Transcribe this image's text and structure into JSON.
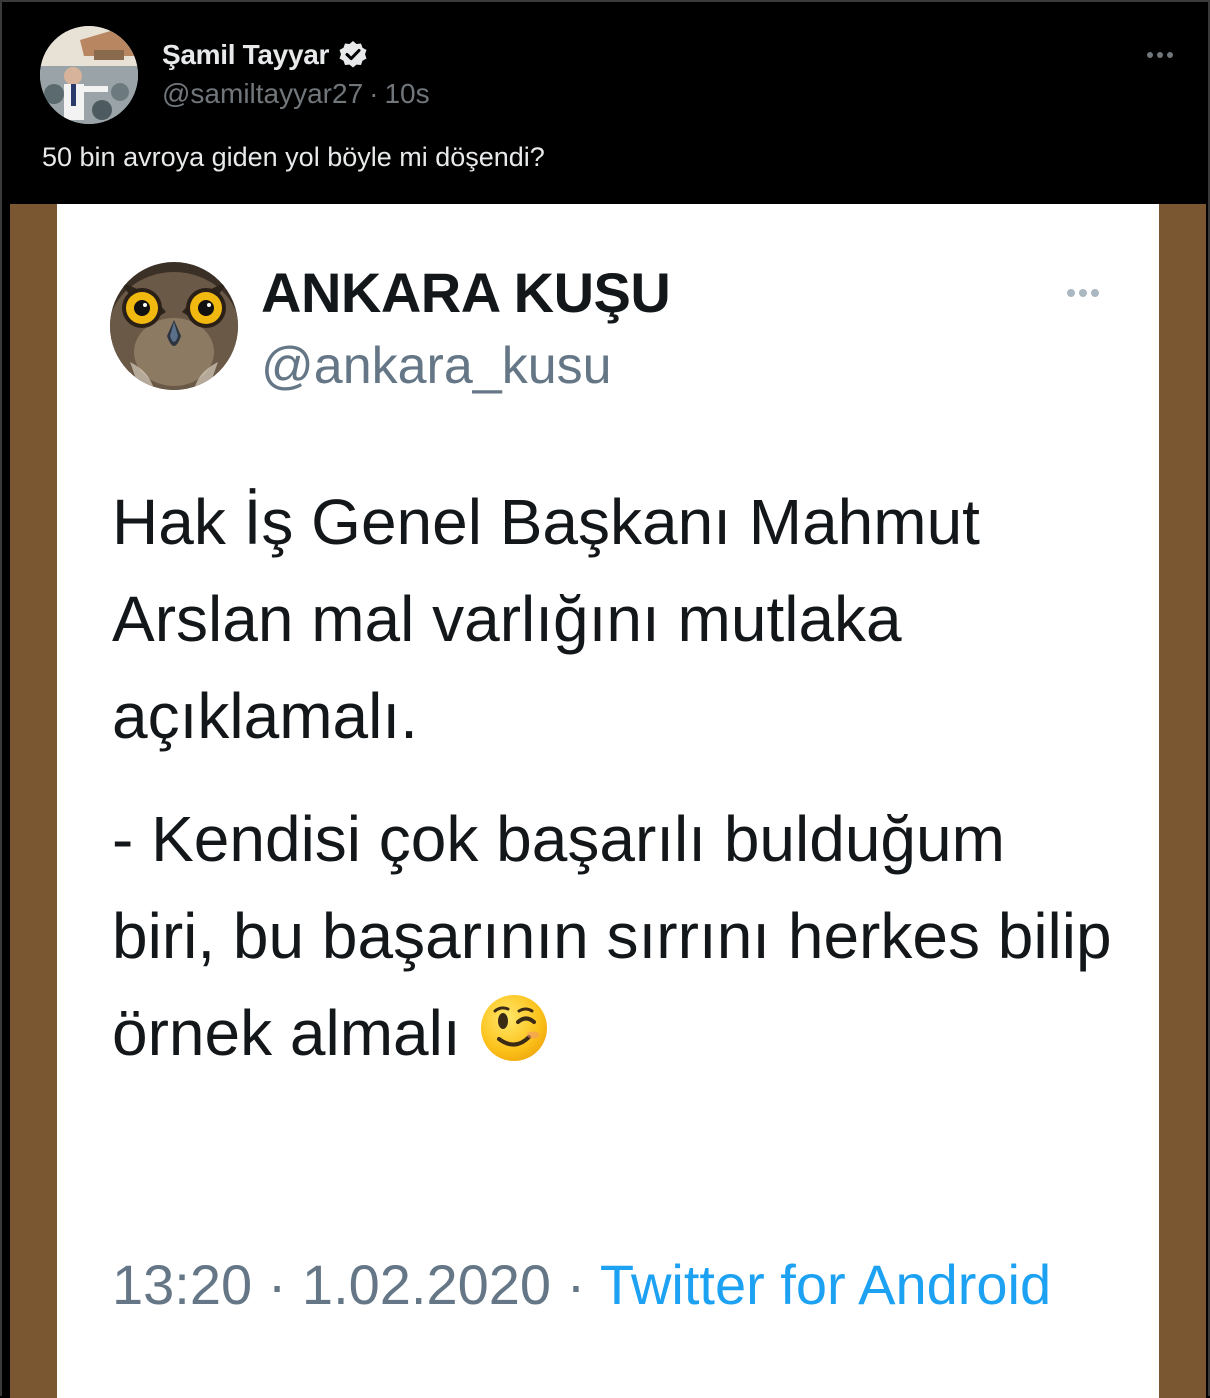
{
  "tweet": {
    "author_name": "Şamil Tayyar",
    "author_handle": "@samiltayyar27",
    "separator": "·",
    "time": "10s",
    "text": "50 bin avroya giden yol böyle mi döşendi?",
    "verified": true,
    "more_icon": "more-horizontal-icon"
  },
  "embedded": {
    "name": "ANKARA KUŞU",
    "handle": "@ankara_kusu",
    "paragraph1": "Hak İş Genel Başkanı Mahmut Arslan mal varlığını mutlaka açıklamalı.",
    "paragraph2": "- Kendisi çok başarılı bulduğum biri, bu başarının sırrını herkes bilip örnek almalı",
    "emoji": "winking-face-emoji",
    "time": "13:20",
    "date": "1.02.2020",
    "meta_separator": "·",
    "source": "Twitter for Android"
  },
  "colors": {
    "background": "#000000",
    "primary_text": "#e7e9ea",
    "secondary_text": "#71767b",
    "media_border": "#7a5730",
    "link": "#1da1f2"
  }
}
